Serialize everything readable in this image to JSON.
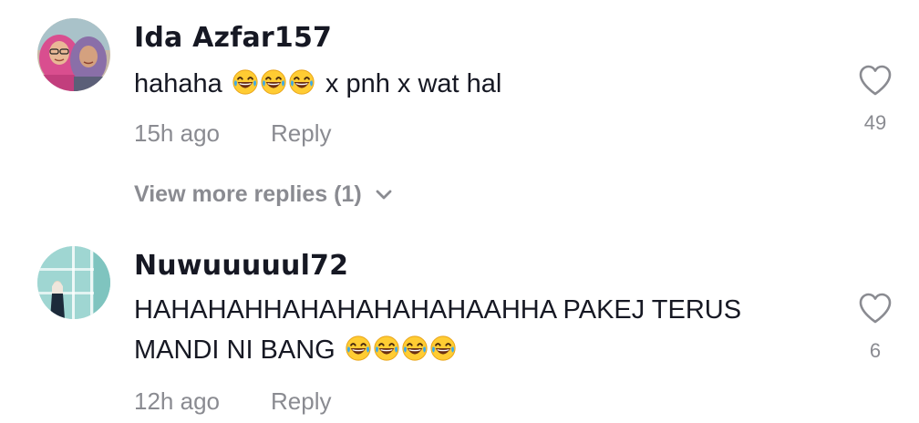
{
  "comments": [
    {
      "username": "Ida Azfar157",
      "text_before": "hahaha",
      "emoji_count": 3,
      "text_after": "x pnh x wat hal",
      "time": "15h ago",
      "reply_label": "Reply",
      "likes": "49",
      "avatar_icon": "profile-photo"
    },
    {
      "username": "Nuwuuuuul72",
      "text_line1": "HAHAHAHHAHAHAHAHAHAAHHA PAKEJ TERUS",
      "text_line2": "MANDI NI BANG",
      "emoji_count": 4,
      "time": "12h ago",
      "reply_label": "Reply",
      "likes": "6",
      "avatar_icon": "profile-photo"
    }
  ],
  "view_more_replies": "View more replies (1)",
  "colors": {
    "primary_text": "#161823",
    "secondary_text": "#8a8b91",
    "background": "#ffffff"
  }
}
